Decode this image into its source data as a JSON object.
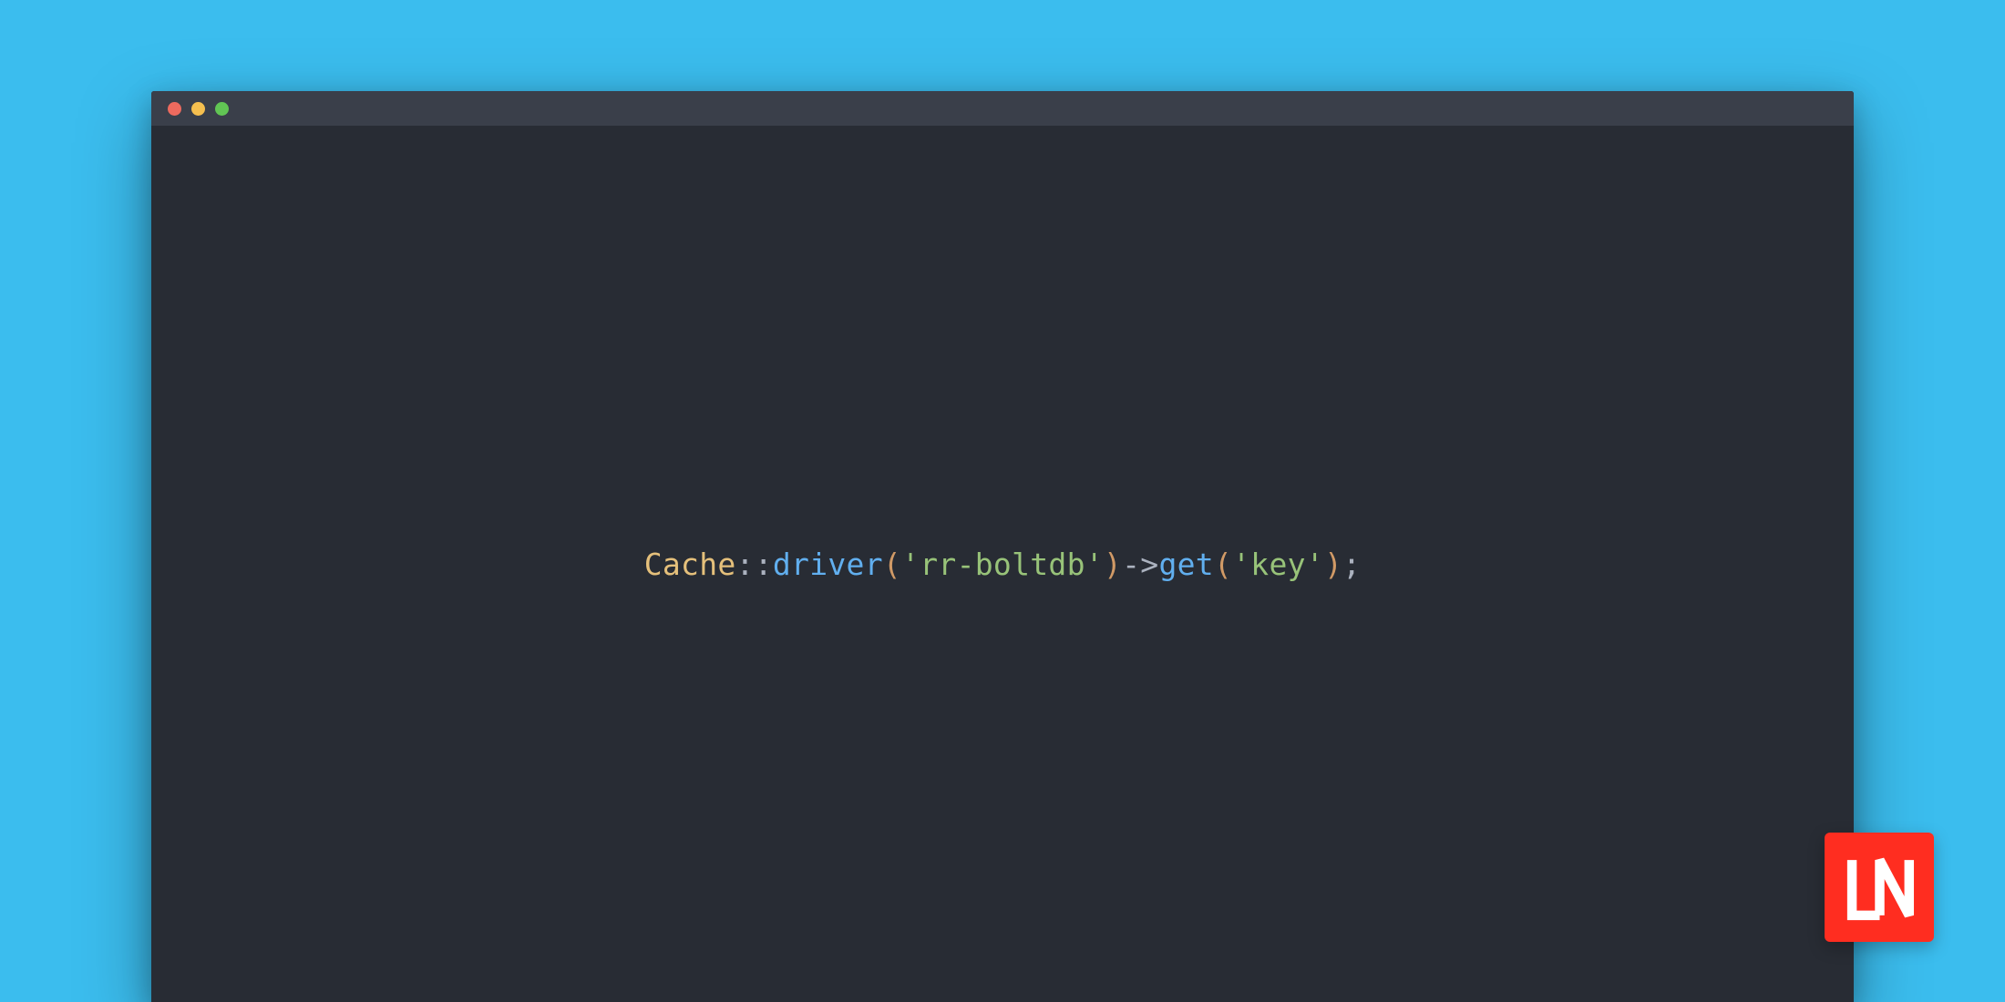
{
  "colors": {
    "page_bg": "#3bbdee",
    "editor_bg": "#282c34",
    "titlebar_bg": "#3a3f4a",
    "traffic_red": "#ed6a5e",
    "traffic_yellow": "#f5bf4f",
    "traffic_green": "#61c554",
    "logo_bg": "#ff2d20"
  },
  "code": {
    "class": "Cache",
    "scope": "::",
    "method1": "driver",
    "paren_open1": "(",
    "string1": "'rr-boltdb'",
    "paren_close1": ")",
    "arrow": "->",
    "method2": "get",
    "paren_open2": "(",
    "string2": "'key'",
    "paren_close2": ")",
    "semicolon": ";"
  },
  "logo": {
    "text": "LN"
  }
}
